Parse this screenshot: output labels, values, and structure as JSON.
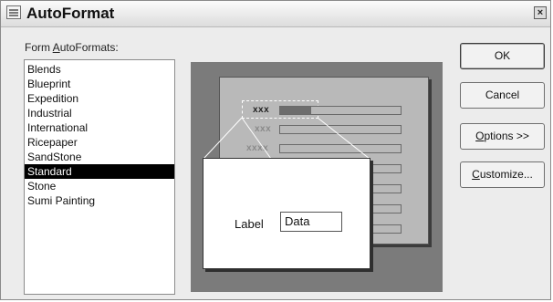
{
  "window": {
    "title": "AutoFormat",
    "close_glyph": "×"
  },
  "list": {
    "label_prefix": "Form ",
    "label_mnemonic": "A",
    "label_suffix": "utoFormats:",
    "items": [
      "Blends",
      "Blueprint",
      "Expedition",
      "Industrial",
      "International",
      "Ricepaper",
      "SandStone",
      "Standard",
      "Stone",
      "Sumi Painting"
    ],
    "selected": "Standard"
  },
  "preview": {
    "row_labels": [
      "xxx",
      "xxx",
      "xxxx"
    ],
    "zoom_label": "Label",
    "zoom_value": "Data"
  },
  "buttons": {
    "ok": "OK",
    "cancel": "Cancel",
    "options_mnemonic": "O",
    "options_rest": "ptions >>",
    "customize_mnemonic": "C",
    "customize_rest": "ustomize..."
  },
  "icons": {
    "app": "form-icon",
    "close": "close-icon"
  }
}
